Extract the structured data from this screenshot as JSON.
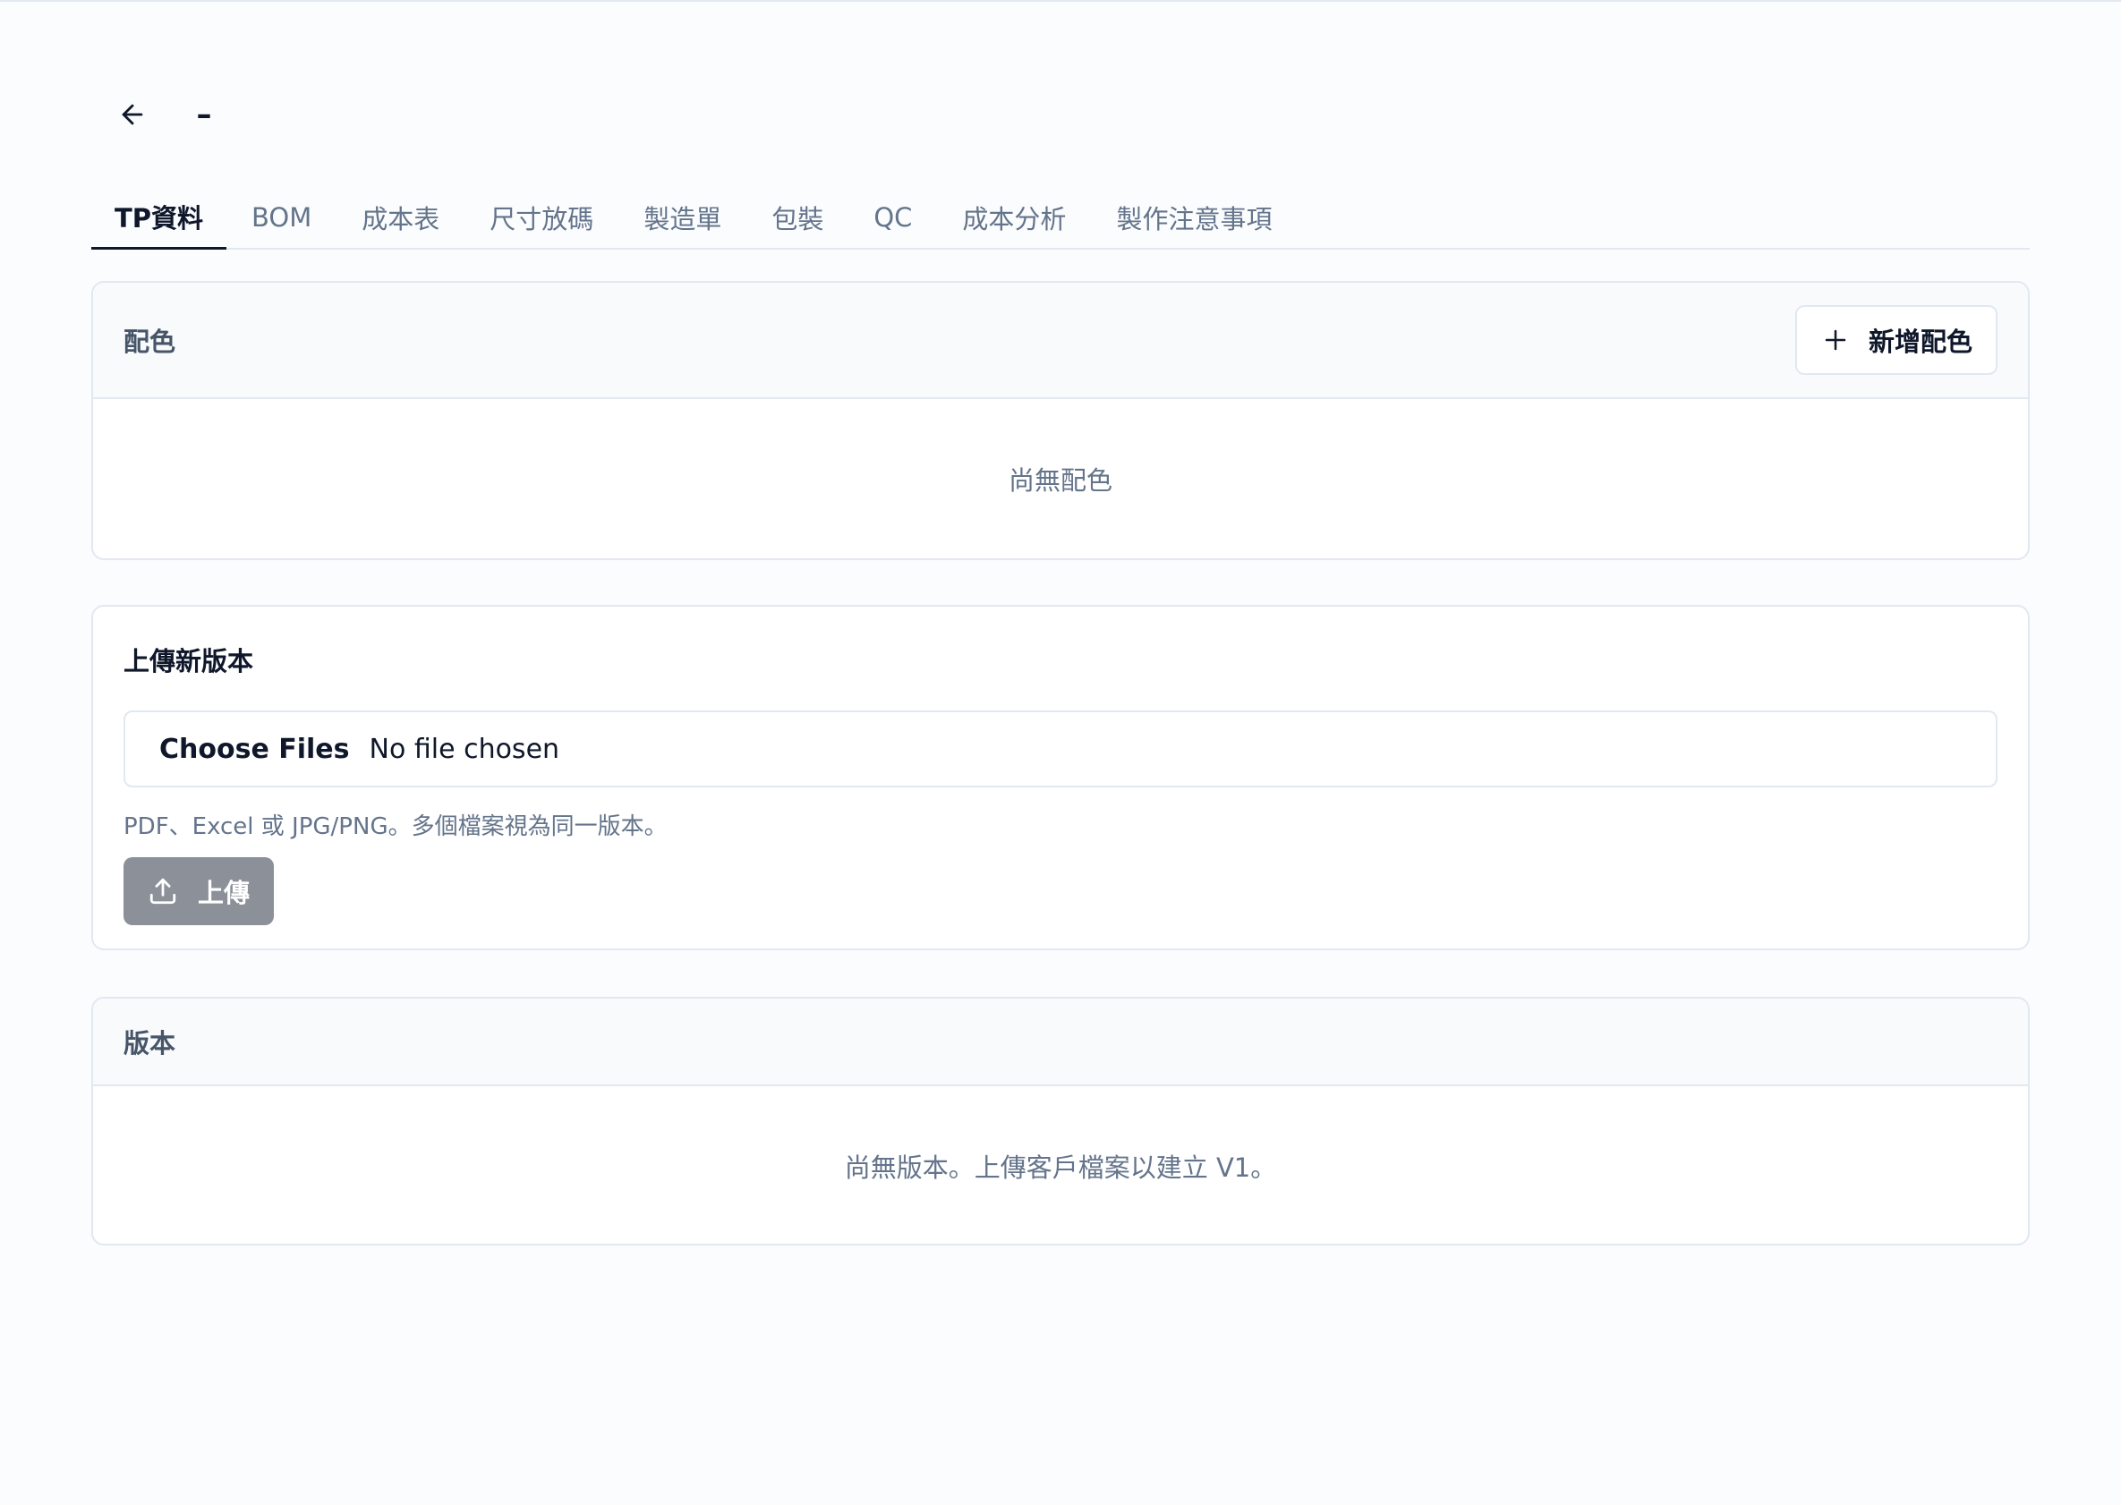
{
  "topbar": {
    "back_icon": "arrow-left-icon",
    "title": "–"
  },
  "tabs": [
    {
      "label": "TP資料",
      "active": true
    },
    {
      "label": "BOM",
      "active": false
    },
    {
      "label": "成本表",
      "active": false
    },
    {
      "label": "尺寸放碼",
      "active": false
    },
    {
      "label": "製造單",
      "active": false
    },
    {
      "label": "包裝",
      "active": false
    },
    {
      "label": "QC",
      "active": false
    },
    {
      "label": "成本分析",
      "active": false
    },
    {
      "label": "製作注意事項",
      "active": false
    }
  ],
  "colors_section": {
    "title": "配色",
    "add_button_label": "新增配色",
    "add_icon": "plus-icon",
    "empty_text": "尚無配色"
  },
  "upload_section": {
    "title": "上傳新版本",
    "file_button_label": "Choose Files",
    "file_status": "No file chosen",
    "hint": "PDF、Excel 或 JPG/PNG。多個檔案視為同一版本。",
    "upload_button_label": "上傳",
    "upload_icon": "upload-icon"
  },
  "versions_section": {
    "title": "版本",
    "empty_text": "尚無版本。上傳客戶檔案以建立 V1。"
  },
  "colors": {
    "page_bg": "#fbfcfe",
    "border": "#e2e8f0",
    "muted_text": "#64748b",
    "disabled_button": "#8b9099"
  }
}
